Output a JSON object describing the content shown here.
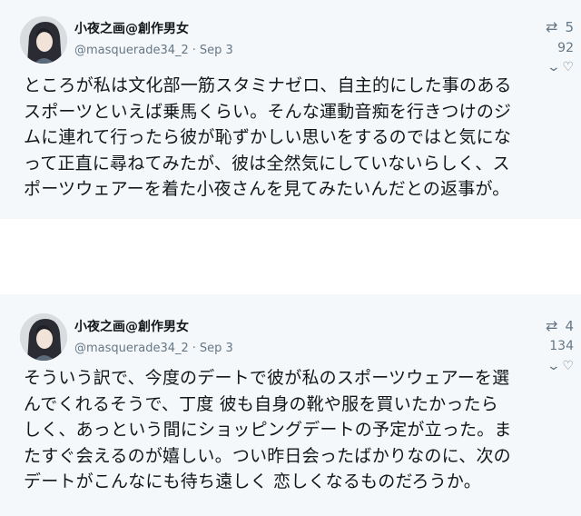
{
  "tweets": [
    {
      "author": "小夜之画@創作男女",
      "handle": "@masquerade34_2",
      "separator": "·",
      "date": "Sep 3",
      "retweets": "5",
      "likes": "92",
      "lines": [
        "ところが私は文化部一筋スタミナゼロ、自主的にした事のある",
        "スポーツといえば乗馬くらい。そんな運動音痴を行きつけのジ",
        "ムに連れて行ったら彼が恥ずかしい思いをするのではと気にな",
        "って正直に尋ねてみたが、彼は全然気にしていないらしく、ス",
        "ポーツウェアーを着た小夜さんを見てみたいんだとの返事が。"
      ]
    },
    {
      "author": "小夜之画@創作男女",
      "handle": "@masquerade34_2",
      "separator": "·",
      "date": "Sep 3",
      "retweets": "4",
      "likes": "134",
      "lines": [
        "そういう訳で、今度のデートで彼が私のスポーツウェアーを選",
        "んでくれるそうで、丁度 彼も自身の靴や服を買いたかったら",
        "しく、あっという間にショッピングデートの予定が立った。ま",
        "たすぐ会えるのが嬉しい。つい昨日会ったばかりなのに、次の",
        "デートがこんなにも待ち遠しく 恋しくなるものだろうか。"
      ]
    }
  ],
  "icons": {
    "retweet": "retweet-icon",
    "chevron": "chevron-down-icon",
    "like": "heart-icon"
  },
  "colors": {
    "card_bg": "#f5f8fa",
    "text": "#14171a",
    "secondary": "#657786"
  }
}
